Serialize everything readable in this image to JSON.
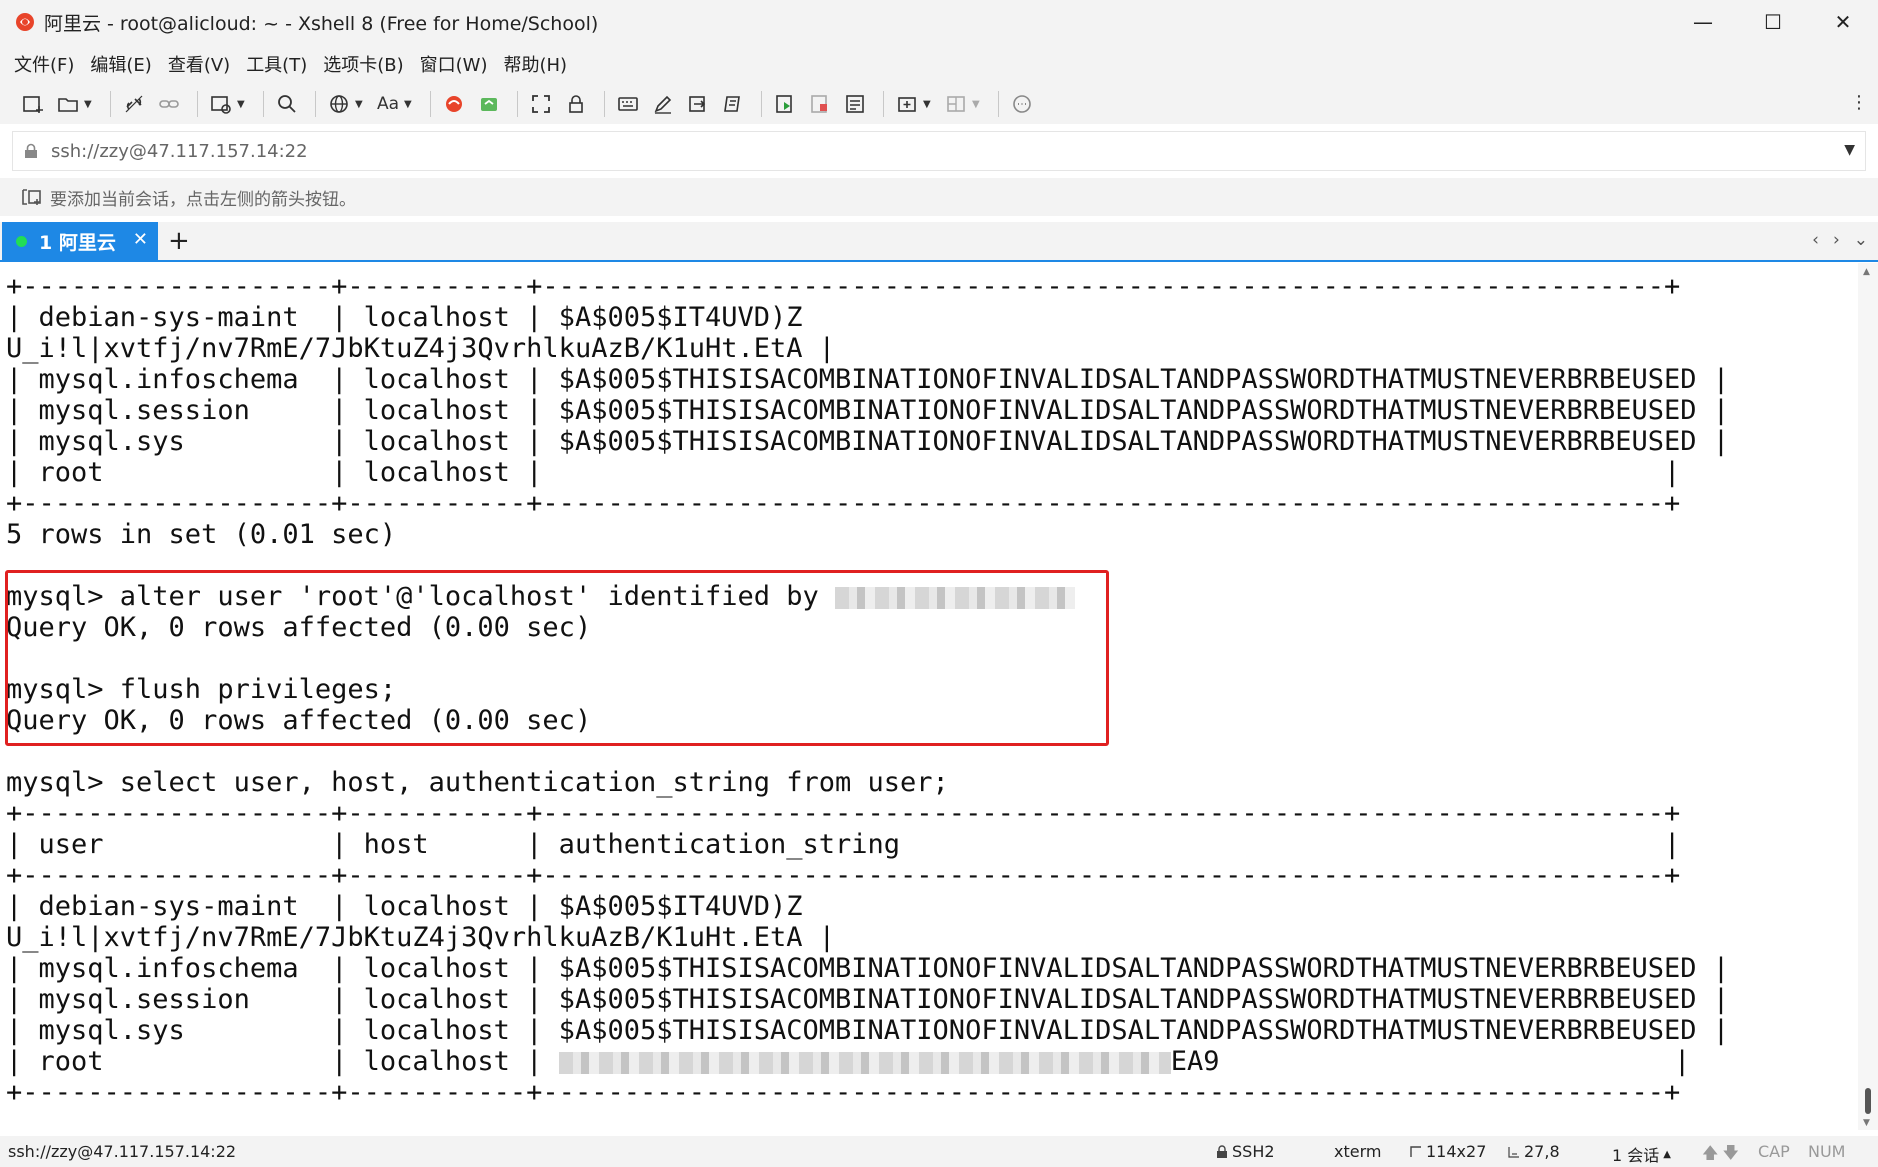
{
  "window": {
    "title": "阿里云 - root@alicloud: ~ - Xshell 8 (Free for Home/School)",
    "minimize": "—",
    "maximize": "☐",
    "close": "✕"
  },
  "menu": [
    "文件(F)",
    "编辑(E)",
    "查看(V)",
    "工具(T)",
    "选项卡(B)",
    "窗口(W)",
    "帮助(H)"
  ],
  "toolbar": {
    "font_label": "Aa",
    "more": "⋮"
  },
  "address": {
    "value": "ssh://zzy@47.117.157.14:22",
    "caret": "▼"
  },
  "hint": {
    "text": "要添加当前会话，点击左侧的箭头按钮。"
  },
  "tabs": {
    "active_label": "1 阿里云",
    "close": "✕",
    "add": "+",
    "prev": "‹",
    "next": "›",
    "menu": "⌄"
  },
  "terminal": {
    "lines": [
      "+-------------------+-----------+---------------------------------------------------------------------+",
      "| debian-sys-maint  | localhost | $A$005$IT4UVD)Z",
      "U_i!l|xvtfj/nv7RmE/7JbKtuZ4j3QvrhlkuAzB/K1uHt.EtA |",
      "| mysql.infoschema  | localhost | $A$005$THISISACOMBINATIONOFINVALIDSALTANDPASSWORDTHATMUSTNEVERBRBEUSED |",
      "| mysql.session     | localhost | $A$005$THISISACOMBINATIONOFINVALIDSALTANDPASSWORDTHATMUSTNEVERBRBEUSED |",
      "| mysql.sys         | localhost | $A$005$THISISACOMBINATIONOFINVALIDSALTANDPASSWORDTHATMUSTNEVERBRBEUSED |",
      "| root              | localhost |                                                                     |",
      "+-------------------+-----------+---------------------------------------------------------------------+",
      "5 rows in set (0.01 sec)",
      "",
      "mysql> alter user 'root'@'localhost' identified by ",
      "Query OK, 0 rows affected (0.00 sec)",
      "",
      "mysql> flush privileges;",
      "Query OK, 0 rows affected (0.00 sec)",
      "",
      "mysql> select user, host, authentication_string from user;",
      "+-------------------+-----------+---------------------------------------------------------------------+",
      "| user              | host      | authentication_string                                               |",
      "+-------------------+-----------+---------------------------------------------------------------------+",
      "| debian-sys-maint  | localhost | $A$005$IT4UVD)Z",
      "U_i!l|xvtfj/nv7RmE/7JbKtuZ4j3QvrhlkuAzB/K1uHt.EtA |",
      "| mysql.infoschema  | localhost | $A$005$THISISACOMBINATIONOFINVALIDSALTANDPASSWORDTHATMUSTNEVERBRBEUSED |",
      "| mysql.session     | localhost | $A$005$THISISACOMBINATIONOFINVALIDSALTANDPASSWORDTHATMUSTNEVERBRBEUSED |",
      "| mysql.sys         | localhost | $A$005$THISISACOMBINATIONOFINVALIDSALTANDPASSWORDTHATMUSTNEVERBRBEUSED |",
      "| root              | localhost | ",
      "+-------------------+-----------+---------------------------------------------------------------------+"
    ],
    "root_hash_suffix": "EA9",
    "root_hash_tail": "                                                                 |"
  },
  "status": {
    "connection": "ssh://zzy@47.117.157.14:22",
    "protocol": "SSH2",
    "term": "xterm",
    "size": "114x27",
    "cursor": "27,8",
    "sessions": "1 会话",
    "caps": "CAP",
    "num": "NUM"
  },
  "colors": {
    "tab_accent": "#1e88e5",
    "highlight_border": "#e02020",
    "tab_dot": "#22dd55"
  }
}
